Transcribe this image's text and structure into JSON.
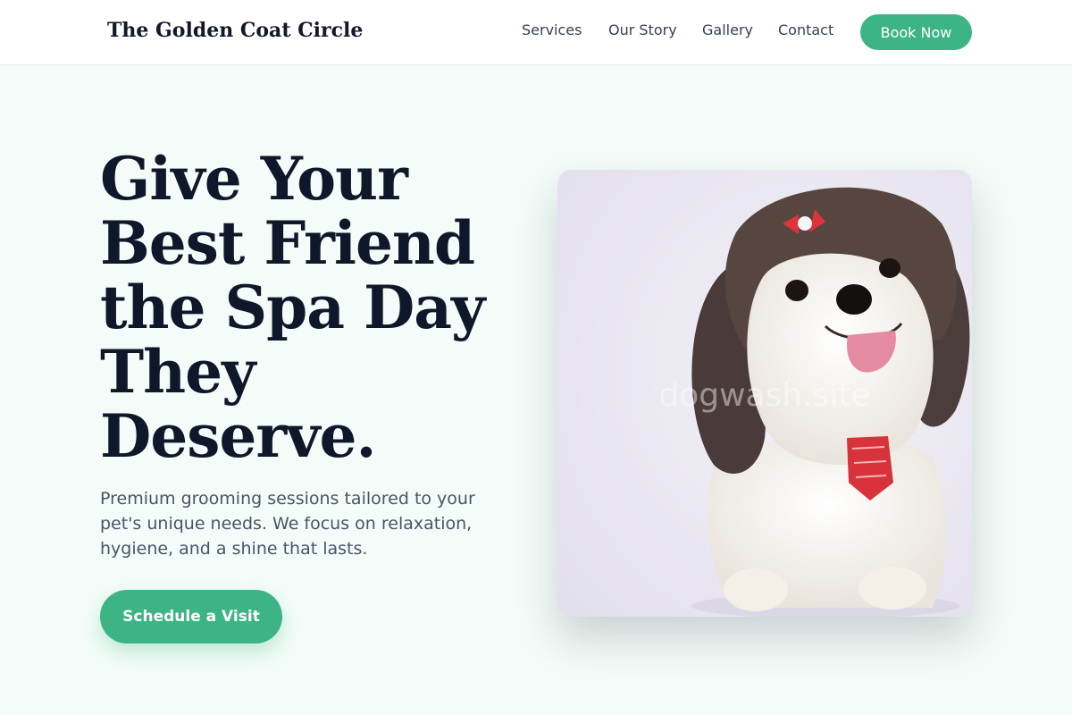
{
  "header": {
    "brand": "The Golden Coat Circle",
    "nav": [
      "Services",
      "Our Story",
      "Gallery",
      "Contact"
    ],
    "book_label": "Book Now"
  },
  "hero": {
    "title": "Give Your Best Friend the Spa Day They Deserve.",
    "subtitle": "Premium grooming sessions tailored to your pet's unique needs. We focus on relaxation, hygiene, and a shine that lasts.",
    "cta_label": "Schedule a Visit"
  },
  "image": {
    "watermark": "dogwash.site"
  },
  "colors": {
    "accent": "#3db486",
    "background": "#f3fcf8",
    "heading": "#0f172a",
    "body_text": "#475569"
  }
}
